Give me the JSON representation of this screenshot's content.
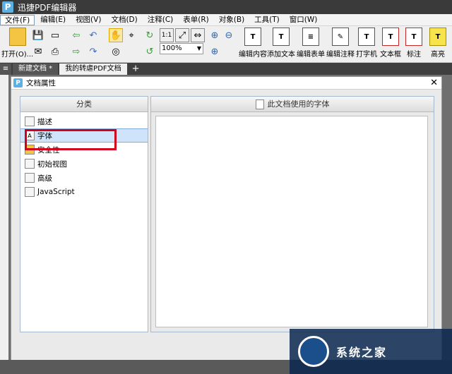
{
  "app": {
    "title": "迅捷PDF编辑器",
    "logo_letter": "P"
  },
  "menu": [
    {
      "label": "文件(F)",
      "active": true
    },
    {
      "label": "编辑(E)"
    },
    {
      "label": "视图(V)"
    },
    {
      "label": "文档(D)"
    },
    {
      "label": "注释(C)"
    },
    {
      "label": "表单(R)"
    },
    {
      "label": "对象(B)"
    },
    {
      "label": "工具(T)"
    },
    {
      "label": "窗口(W)"
    }
  ],
  "toolbar": {
    "open_label": "打开(O)...",
    "zoom_value": "100%",
    "big_buttons": [
      {
        "label": "编辑内容",
        "icon": "T"
      },
      {
        "label": "添加文本",
        "icon": "T"
      },
      {
        "label": "编辑表单",
        "icon": "≡"
      },
      {
        "label": "编辑注释",
        "icon": "✎"
      },
      {
        "label": "打字机",
        "icon": "T"
      },
      {
        "label": "文本框",
        "icon": "T"
      },
      {
        "label": "标注",
        "icon": "T"
      },
      {
        "label": "高亮",
        "icon": "T"
      }
    ]
  },
  "tabs": [
    {
      "label": "新建文档 *"
    },
    {
      "label": "我的转虐PDF文档",
      "active": true
    }
  ],
  "dialog": {
    "title": "文档属性",
    "category_header": "分类",
    "fonts_header": "此文档使用的字体",
    "categories": [
      {
        "label": "描述",
        "icon": "doc-icon"
      },
      {
        "label": "字体",
        "icon": "font-icon",
        "selected": true
      },
      {
        "label": "安全性",
        "icon": "lock-icon"
      },
      {
        "label": "初始视图",
        "icon": "view-icon"
      },
      {
        "label": "高级",
        "icon": "advanced-icon"
      },
      {
        "label": "JavaScript",
        "icon": "script-icon"
      }
    ]
  },
  "watermark": {
    "text": "系统之家"
  }
}
